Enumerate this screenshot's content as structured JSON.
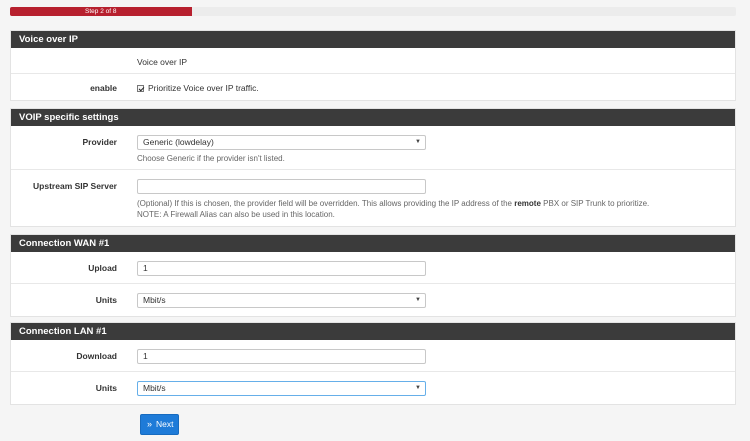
{
  "progress": {
    "label": "Step 2 of 8",
    "fraction": 0.25
  },
  "voip": {
    "heading": "Voice over IP",
    "title_value": "Voice over IP",
    "enable_label": "enable",
    "enable_checked": true,
    "enable_text": "Prioritize Voice over IP traffic."
  },
  "settings": {
    "heading": "VOIP specific settings",
    "provider_label": "Provider",
    "provider_value": "Generic (lowdelay)",
    "provider_help": "Choose Generic if the provider isn't listed.",
    "sip_label": "Upstream SIP Server",
    "sip_value": "",
    "sip_help_1": "(Optional) If this is chosen, the provider field will be overridden. This allows providing the IP address of the ",
    "sip_help_bold": "remote",
    "sip_help_2": " PBX or SIP Trunk to prioritize.",
    "sip_help_note": "NOTE: A Firewall Alias can also be used in this location."
  },
  "wan": {
    "heading": "Connection WAN #1",
    "upload_label": "Upload",
    "upload_value": "1",
    "units_label": "Units",
    "units_value": "Mbit/s"
  },
  "lan": {
    "heading": "Connection LAN #1",
    "download_label": "Download",
    "download_value": "1",
    "units_label": "Units",
    "units_value": "Mbit/s"
  },
  "next_button": {
    "icon": "double-chevron-right-icon",
    "label": "Next"
  },
  "colors": {
    "header_bg": "#3b3b3b",
    "progress": "#b7202e",
    "primary": "#1e7bd8"
  }
}
